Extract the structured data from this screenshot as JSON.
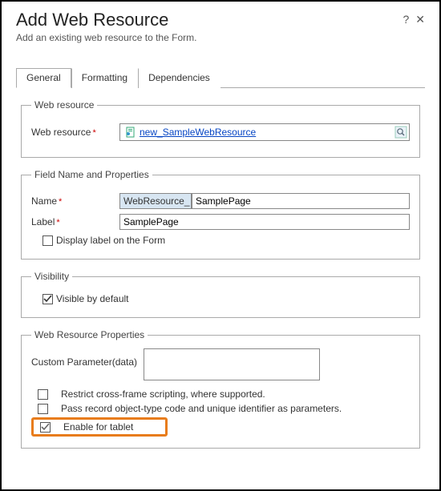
{
  "dialog": {
    "title": "Add Web Resource",
    "subtitle": "Add an existing web resource to the Form."
  },
  "tabs": {
    "general": "General",
    "formatting": "Formatting",
    "dependencies": "Dependencies"
  },
  "webResourceSection": {
    "legend": "Web resource",
    "fieldLabel": "Web resource",
    "lookupValue": "new_SampleWebResource"
  },
  "fieldNameSection": {
    "legend": "Field Name and Properties",
    "nameLabel": "Name",
    "namePrefix": "WebResource_",
    "nameValue": "SamplePage",
    "labelLabel": "Label",
    "labelValue": "SamplePage",
    "displayLabelCheckbox": "Display label on the Form"
  },
  "visibilitySection": {
    "legend": "Visibility",
    "visibleCheckbox": "Visible by default"
  },
  "wrpSection": {
    "legend": "Web Resource Properties",
    "customParamLabel": "Custom Parameter(data)",
    "customParamValue": "",
    "restrictXFrame": "Restrict cross-frame scripting, where supported.",
    "passRecord": "Pass record object-type code and unique identifier as parameters.",
    "enableTablet": "Enable for tablet"
  }
}
